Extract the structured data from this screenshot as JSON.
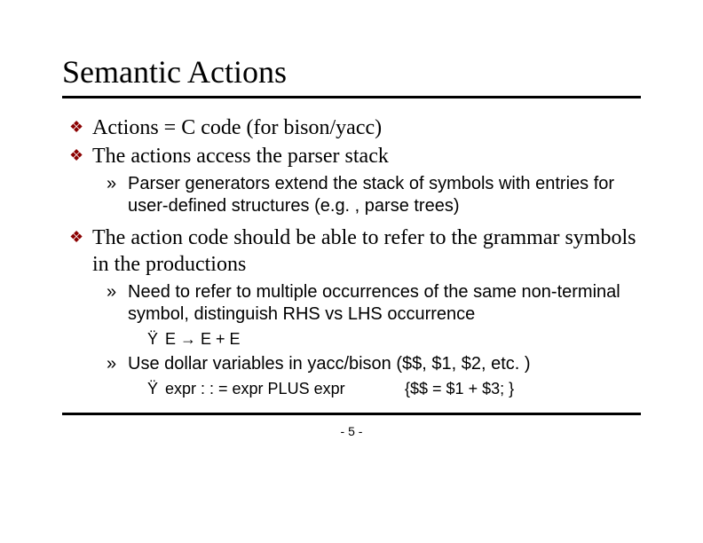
{
  "title": "Semantic Actions",
  "bullets": {
    "b1": "Actions = C code (for bison/yacc)",
    "b2": "The actions access the parser stack",
    "b2_1": "Parser generators extend the stack of symbols with entries for user-defined structures (e.g. , parse trees)",
    "b3": "The action code should be able to refer to the grammar symbols in the productions",
    "b3_1": "Need to refer to multiple occurrences of the same non-terminal symbol, distinguish RHS vs LHS occurrence",
    "b3_1_1": "E → E + E",
    "b3_2": "Use dollar variables in yacc/bison ($$, $1, $2, etc. )",
    "b3_2_1_left": "expr : : = expr PLUS expr",
    "b3_2_1_right": "{$$ = $1 + $3; }"
  },
  "glyphs": {
    "diamond": "❖",
    "raquo": "»",
    "ydia": "Ÿ"
  },
  "page": "- 5 -"
}
